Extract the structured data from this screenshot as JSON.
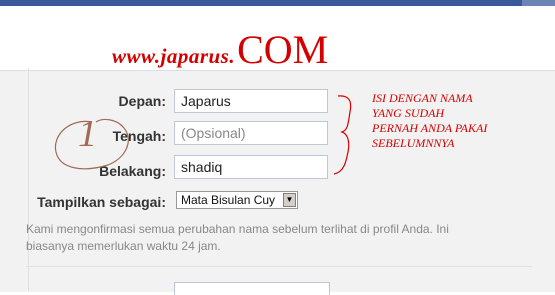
{
  "overlay": {
    "watermark_part1": "www.japarus.",
    "watermark_part2": "COM",
    "step_number": "1",
    "note_lines": [
      "ISI DENGAN NAMA",
      "YANG SUDAH",
      "PERNAH ANDA PAKAI",
      "SEBELUMNNYA"
    ]
  },
  "form": {
    "first_label": "Depan:",
    "first_value": "Japarus",
    "middle_label": "Tengah:",
    "middle_placeholder": "(Opsional)",
    "last_label": "Belakang:",
    "last_value": "shadiq",
    "display_label": "Tampilkan sebagai:",
    "display_value": "Mata Bisulan Cuy",
    "info": "Kami mengonfirmasi semua perubahan nama sebelum terlihat di profil Anda. Ini biasanya memerlukan waktu 24 jam."
  },
  "colors": {
    "annotation": "#d40000",
    "header": "#3b5998",
    "number": "#a06a55"
  },
  "icons": {
    "select_arrow": "dropdown-arrow-icon"
  }
}
